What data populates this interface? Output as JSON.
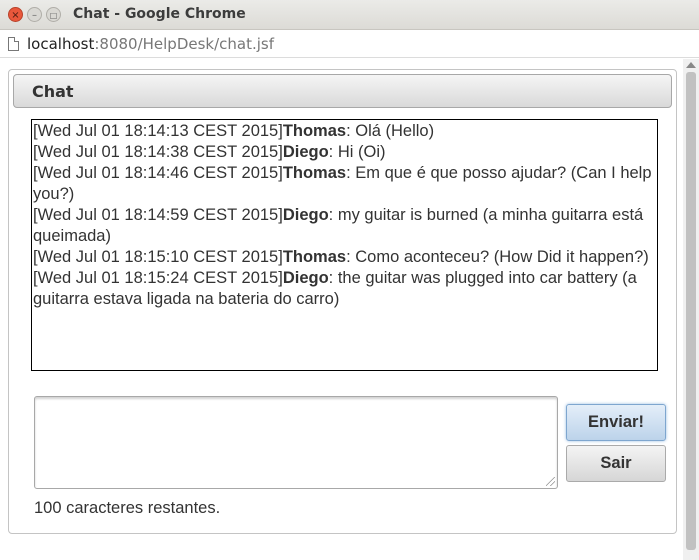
{
  "window": {
    "title": "Chat - Google Chrome",
    "close_glyph": "×",
    "minimize_glyph": "–",
    "maximize_glyph": "□"
  },
  "address_bar": {
    "host": "localhost",
    "path": ":8080/HelpDesk/chat.jsf"
  },
  "panel": {
    "title": "Chat"
  },
  "chat": {
    "messages": [
      {
        "timestamp": "[Wed Jul 01 18:14:13 CEST 2015]",
        "sender": "Thomas",
        "text": ": Olá (Hello)"
      },
      {
        "timestamp": "[Wed Jul 01 18:14:38 CEST 2015]",
        "sender": "Diego",
        "text": ": Hi (Oi)"
      },
      {
        "timestamp": "[Wed Jul 01 18:14:46 CEST 2015]",
        "sender": "Thomas",
        "text": ": Em que é que posso ajudar? (Can I help you?)"
      },
      {
        "timestamp": "[Wed Jul 01 18:14:59 CEST 2015]",
        "sender": "Diego",
        "text": ": my guitar is burned (a minha guitarra está queimada)"
      },
      {
        "timestamp": "[Wed Jul 01 18:15:10 CEST 2015]",
        "sender": "Thomas",
        "text": ": Como aconteceu? (How Did it happen?)"
      },
      {
        "timestamp": "[Wed Jul 01 18:15:24 CEST 2015]",
        "sender": "Diego",
        "text": ": the guitar was plugged into car battery (a guitarra estava ligada na bateria do carro)"
      }
    ]
  },
  "compose": {
    "value": "",
    "send_label": "Enviar!",
    "exit_label": "Sair",
    "counter_text": "100 caracteres restantes."
  },
  "colors": {
    "send_button_border": "#7ea6cf",
    "close_button": "#e9573b"
  }
}
